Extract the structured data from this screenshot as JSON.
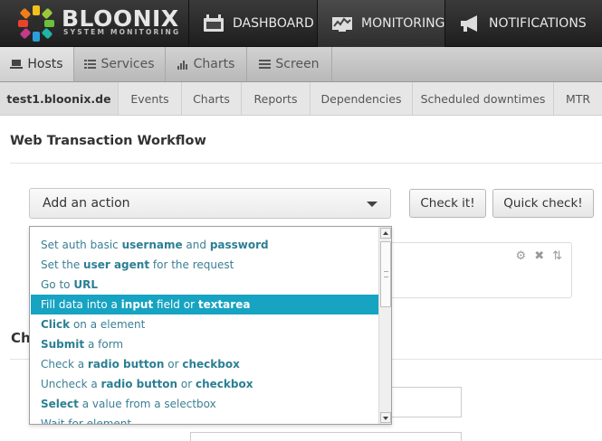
{
  "brand": {
    "name": "BLOONIX",
    "tagline": "SYSTEM MONITORING"
  },
  "topnav": [
    {
      "label": "DASHBOARD",
      "icon": "dashboard-icon"
    },
    {
      "label": "MONITORING",
      "icon": "monitoring-icon",
      "active": true
    },
    {
      "label": "NOTIFICATIONS",
      "icon": "megaphone-icon"
    }
  ],
  "subnav": [
    {
      "label": "Hosts",
      "icon": "laptop-icon",
      "active": true
    },
    {
      "label": "Services",
      "icon": "list-icon"
    },
    {
      "label": "Charts",
      "icon": "bar-chart-icon"
    },
    {
      "label": "Screen",
      "icon": "screen-list-icon"
    }
  ],
  "hostnav": [
    {
      "label": "test1.bloonix.de",
      "active": true
    },
    {
      "label": "Events"
    },
    {
      "label": "Charts"
    },
    {
      "label": "Reports"
    },
    {
      "label": "Dependencies"
    },
    {
      "label": "Scheduled downtimes"
    },
    {
      "label": "MTR"
    }
  ],
  "page": {
    "title": "Web Transaction Workflow",
    "select_label": "Add an action",
    "check_button": "Check it!",
    "quick_check_button": "Quick check!",
    "partial_heading": "Ch"
  },
  "actions": [
    {
      "parts": [
        [
          "Set auth basic ",
          false
        ],
        [
          "username",
          true
        ],
        [
          " and ",
          false
        ],
        [
          "password",
          true
        ]
      ]
    },
    {
      "parts": [
        [
          "Set the ",
          false
        ],
        [
          "user agent",
          true
        ],
        [
          " for the request",
          false
        ]
      ]
    },
    {
      "parts": [
        [
          "Go to ",
          false
        ],
        [
          "URL",
          true
        ]
      ]
    },
    {
      "parts": [
        [
          "Fill data into a ",
          false
        ],
        [
          "input",
          true
        ],
        [
          " field or ",
          false
        ],
        [
          "textarea",
          true
        ]
      ],
      "highlighted": true
    },
    {
      "parts": [
        [
          "Click",
          true
        ],
        [
          " on a element",
          false
        ]
      ]
    },
    {
      "parts": [
        [
          "Submit",
          true
        ],
        [
          " a form",
          false
        ]
      ]
    },
    {
      "parts": [
        [
          "Check a ",
          false
        ],
        [
          "radio button",
          true
        ],
        [
          " or ",
          false
        ],
        [
          "checkbox",
          true
        ]
      ]
    },
    {
      "parts": [
        [
          "Uncheck a ",
          false
        ],
        [
          "radio button",
          true
        ],
        [
          " or ",
          false
        ],
        [
          "checkbox",
          true
        ]
      ]
    },
    {
      "parts": [
        [
          "Select",
          true
        ],
        [
          " a value from a selectbox",
          false
        ]
      ]
    },
    {
      "parts": [
        [
          "Wait for element",
          false
        ]
      ]
    }
  ],
  "colors": {
    "highlight": "#17a3c2",
    "link": "#3a7f95"
  }
}
